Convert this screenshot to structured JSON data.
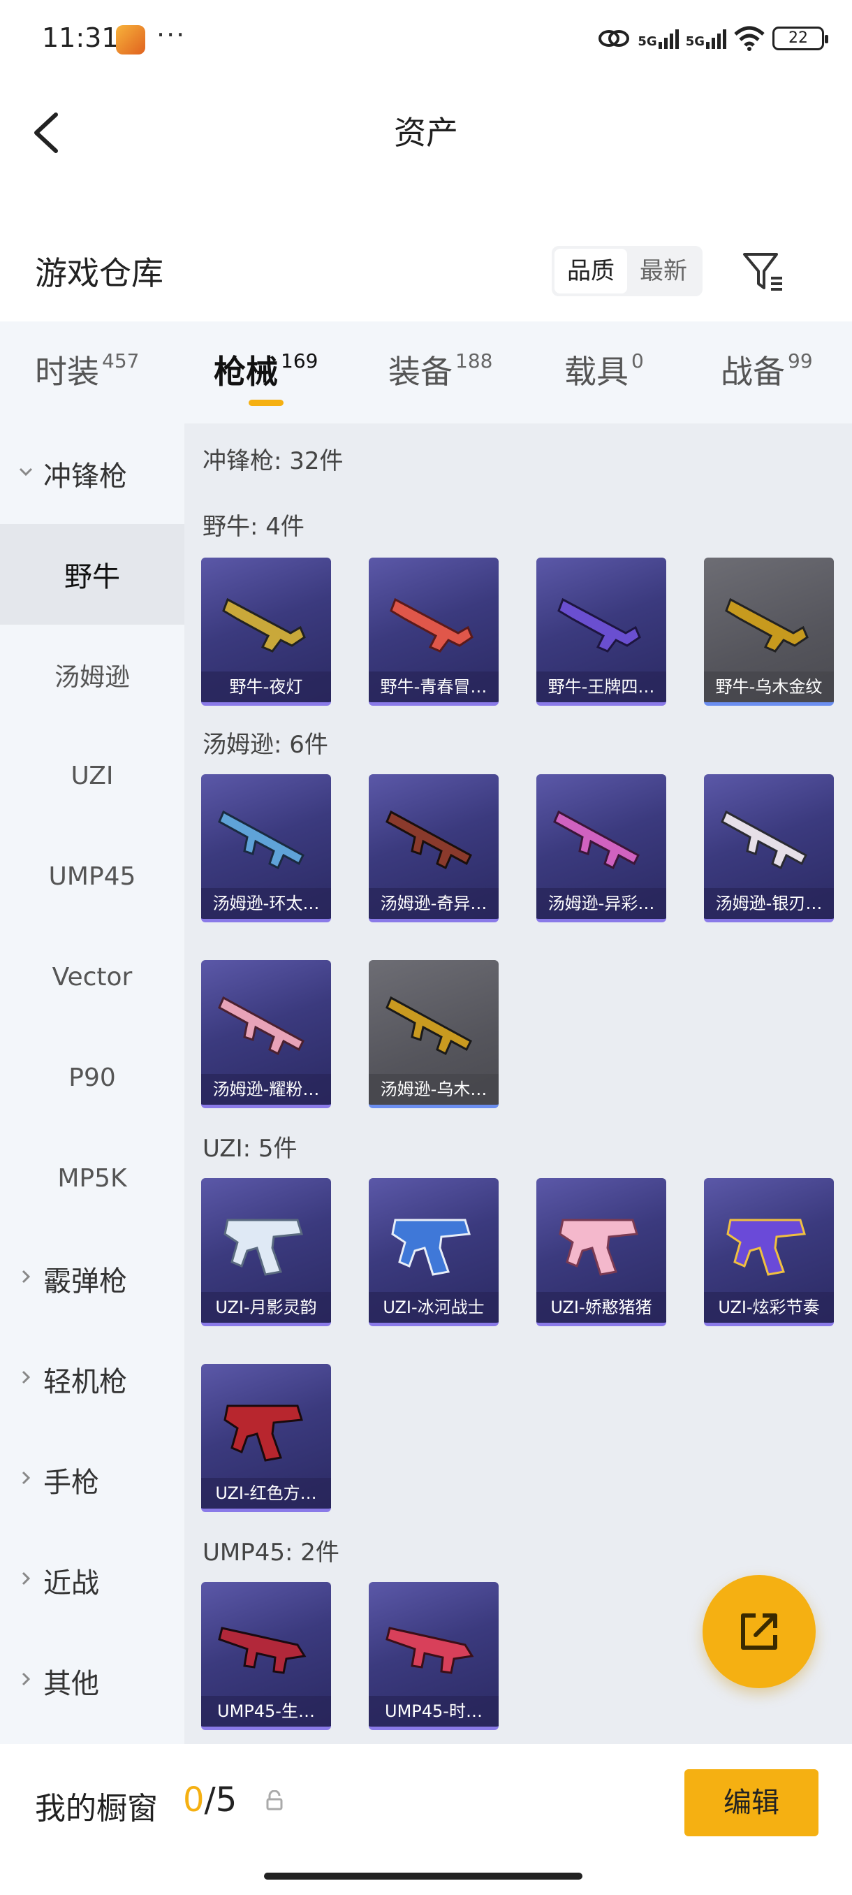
{
  "status_bar": {
    "time": "11:31",
    "dots": "···",
    "network_1": "5G",
    "network_2": "5G",
    "battery": "22"
  },
  "header": {
    "title": "资产",
    "back_icon": "chevron-left-icon"
  },
  "warehouse": {
    "title": "游戏仓库",
    "sort_options": [
      "品质",
      "最新"
    ],
    "sort_selected": "品质",
    "filter_icon": "filter-icon"
  },
  "tabs": [
    {
      "label": "时装",
      "count": "457"
    },
    {
      "label": "枪械",
      "count": "169",
      "active": true
    },
    {
      "label": "装备",
      "count": "188"
    },
    {
      "label": "载具",
      "count": "0"
    },
    {
      "label": "战备",
      "count": "99"
    }
  ],
  "sidebar": {
    "expanded_category": "冲锋枪",
    "items": [
      "野牛",
      "汤姆逊",
      "UZI",
      "UMP45",
      "Vector",
      "P90",
      "MP5K"
    ],
    "active_item": "野牛",
    "collapsed_categories": [
      "霰弹枪",
      "轻机枪",
      "手枪",
      "近战",
      "其他"
    ]
  },
  "content": {
    "category_total": "冲锋枪: 32件",
    "groups": [
      {
        "title": "野牛: 4件",
        "items": [
          {
            "name": "野牛-夜灯",
            "gray": false
          },
          {
            "name": "野牛-青春冒…",
            "gray": false
          },
          {
            "name": "野牛-王牌四…",
            "gray": false
          },
          {
            "name": "野牛-乌木金纹",
            "gray": true
          }
        ]
      },
      {
        "title": "汤姆逊: 6件",
        "items": [
          {
            "name": "汤姆逊-环太…",
            "gray": false
          },
          {
            "name": "汤姆逊-奇异…",
            "gray": false
          },
          {
            "name": "汤姆逊-异彩…",
            "gray": false
          },
          {
            "name": "汤姆逊-银刃…",
            "gray": false
          },
          {
            "name": "汤姆逊-耀粉…",
            "gray": false
          },
          {
            "name": "汤姆逊-乌木…",
            "gray": true
          }
        ]
      },
      {
        "title": "UZI: 5件",
        "items": [
          {
            "name": "UZI-月影灵韵",
            "gray": false
          },
          {
            "name": "UZI-冰河战士",
            "gray": false
          },
          {
            "name": "UZI-娇憨猪猪",
            "gray": false
          },
          {
            "name": "UZI-炫彩节奏",
            "gray": false
          },
          {
            "name": "UZI-红色方…",
            "gray": false
          }
        ]
      },
      {
        "title": "UMP45: 2件",
        "items": [
          {
            "name": "UMP45-生…",
            "gray": false
          },
          {
            "name": "UMP45-时…",
            "gray": false
          }
        ]
      }
    ]
  },
  "fab": {
    "icon": "share-icon"
  },
  "bottom_bar": {
    "title": "我的橱窗",
    "count_current": "0",
    "count_sep_total": "/5",
    "lock_icon": "lock-icon",
    "edit_label": "编辑"
  },
  "colors": {
    "accent": "#f5b012",
    "card_purple": "#3b3a7e",
    "card_gray": "#55555c"
  }
}
